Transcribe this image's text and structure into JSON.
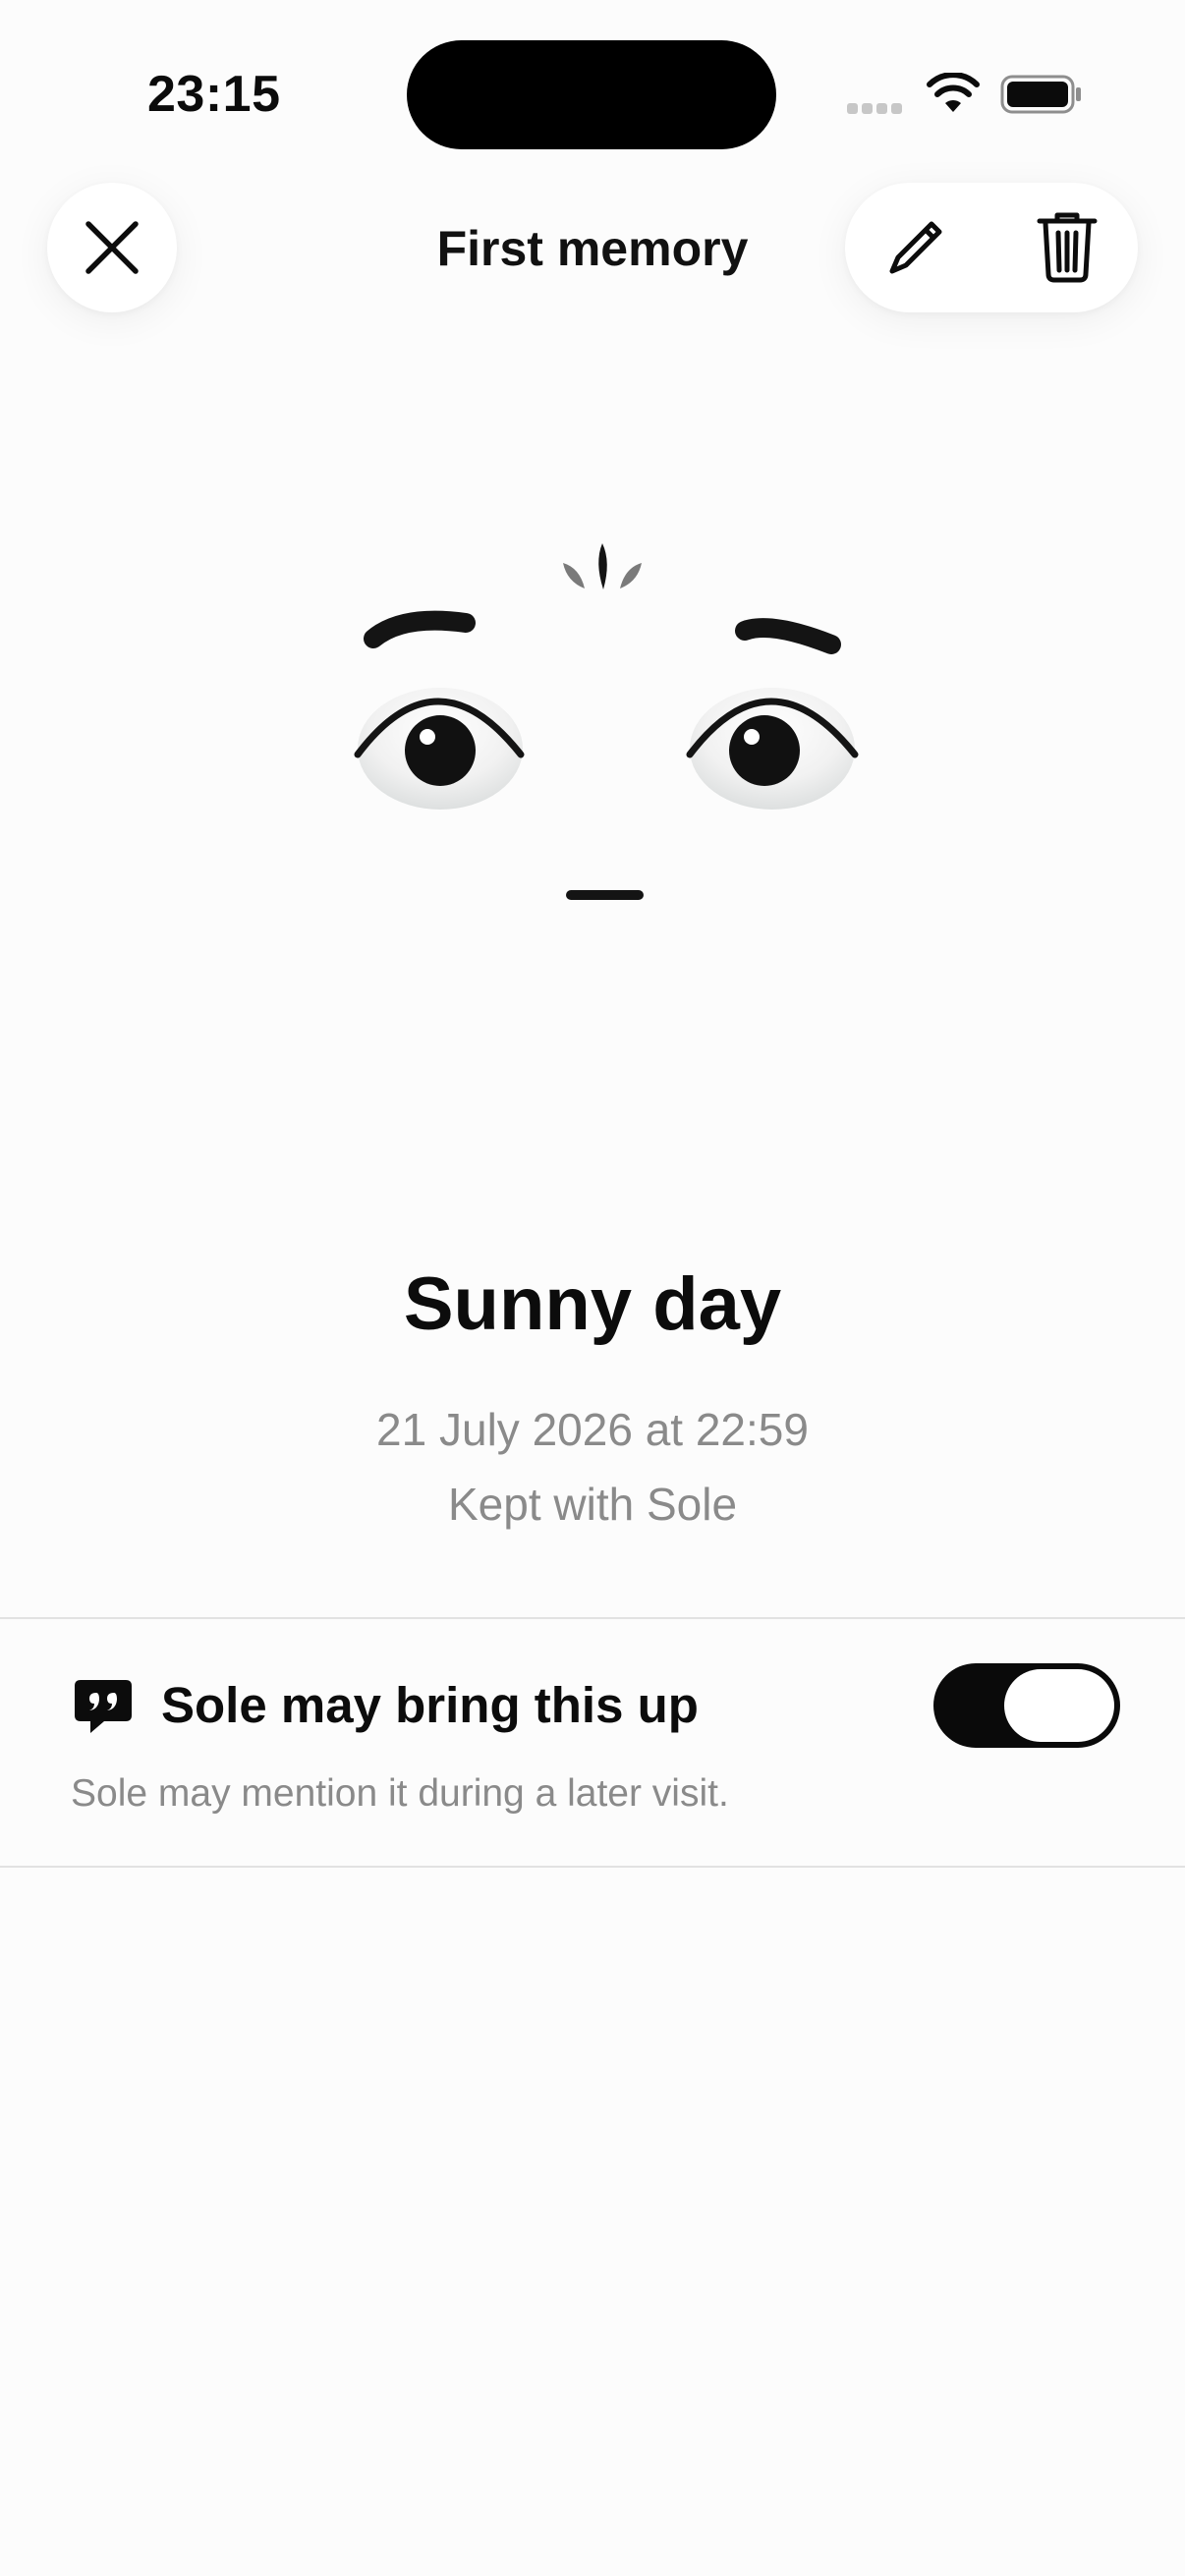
{
  "status_bar": {
    "time": "23:15",
    "icons": [
      "signal-dots-icon",
      "wifi-icon",
      "battery-icon"
    ]
  },
  "nav": {
    "title": "First memory",
    "close_icon": "close-icon",
    "edit_icon": "pencil-icon",
    "delete_icon": "trash-icon"
  },
  "memory": {
    "title": "Sunny day",
    "date": "21 July 2026 at 22:59",
    "kept_with": "Kept with Sole"
  },
  "setting": {
    "icon": "quote-bubble-icon",
    "label": "Sole may bring this up",
    "description": "Sole may mention it during a later visit.",
    "enabled": true
  },
  "colors": {
    "background": "#fcfcfc",
    "text_primary": "#0c0c0c",
    "text_secondary": "#8a8a8a",
    "toggle_on": "#0a0a0a",
    "divider": "#e2e2e2"
  }
}
